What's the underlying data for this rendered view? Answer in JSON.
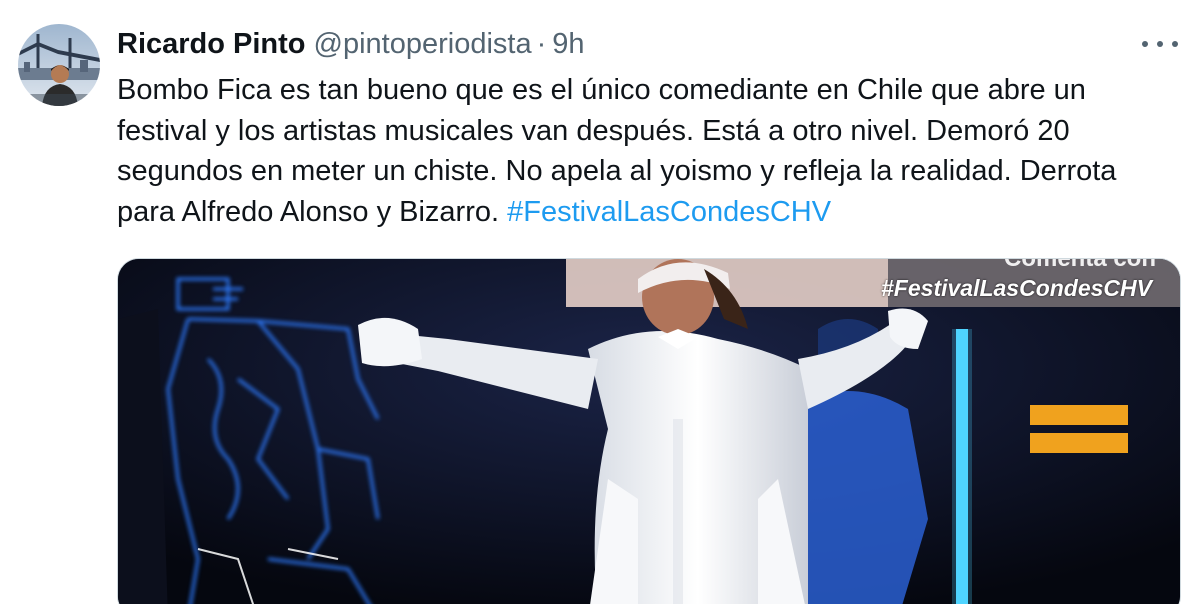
{
  "tweet": {
    "author": {
      "display_name": "Ricardo Pinto",
      "handle": "@pintoperiodista",
      "separator": "·",
      "time": "9h"
    },
    "text_parts": {
      "body": "Bombo Fica es tan bueno que es el único comediante en Chile que abre un festival y los artistas musicales van después. Está a otro nivel. Demoró 20 segundos en meter un chiste. No apela al yoismo y refleja la realidad. Derrota para Alfredo Alonso y Bizarro. ",
      "hashtag": "#FestivalLasCondesCHV"
    },
    "media": {
      "overlay_top": "Comenta con",
      "overlay_hashtag": "#FestivalLasCondesCHV"
    }
  },
  "colors": {
    "text": "#0f1419",
    "secondary": "#536471",
    "link": "#1d9bf0",
    "media_bg": "#0a0e22",
    "led_blue": "#2f7bff",
    "stage_orange": "#f0a21e"
  },
  "icons": {
    "more": "more-horizontal-icon"
  }
}
